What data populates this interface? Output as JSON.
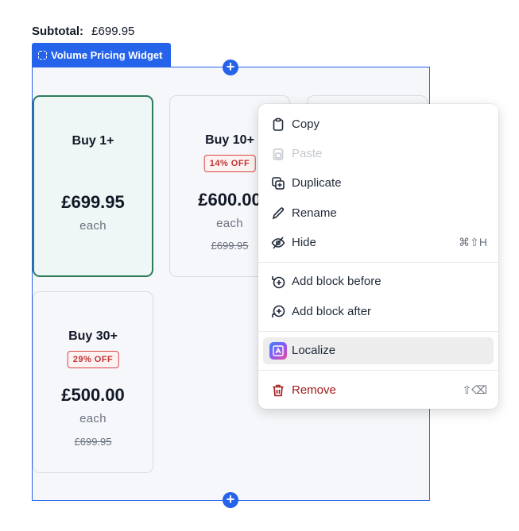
{
  "subtotal": {
    "label": "Subtotal:",
    "value": "£699.95"
  },
  "widget": {
    "tab_label": "Volume Pricing Widget"
  },
  "cards": [
    {
      "title": "Buy 1+",
      "badge": "",
      "price": "£699.95",
      "each": "each",
      "original": ""
    },
    {
      "title": "Buy 10+",
      "badge": "14% OFF",
      "price": "£600.00",
      "each": "each",
      "original": "£699.95"
    },
    {
      "title": "Buy 30+",
      "badge": "29% OFF",
      "price": "£500.00",
      "each": "each",
      "original": "£699.95"
    }
  ],
  "menu": {
    "copy": "Copy",
    "paste": "Paste",
    "duplicate": "Duplicate",
    "rename": "Rename",
    "hide": "Hide",
    "hide_shortcut": "⌘⇧H",
    "add_before": "Add block before",
    "add_after": "Add block after",
    "localize": "Localize",
    "remove": "Remove",
    "remove_shortcut": "⇧⌫"
  },
  "colors": {
    "accent": "#2563eb",
    "active_border": "#2e7d5b",
    "danger": "#a11919",
    "badge": "#d64545"
  }
}
